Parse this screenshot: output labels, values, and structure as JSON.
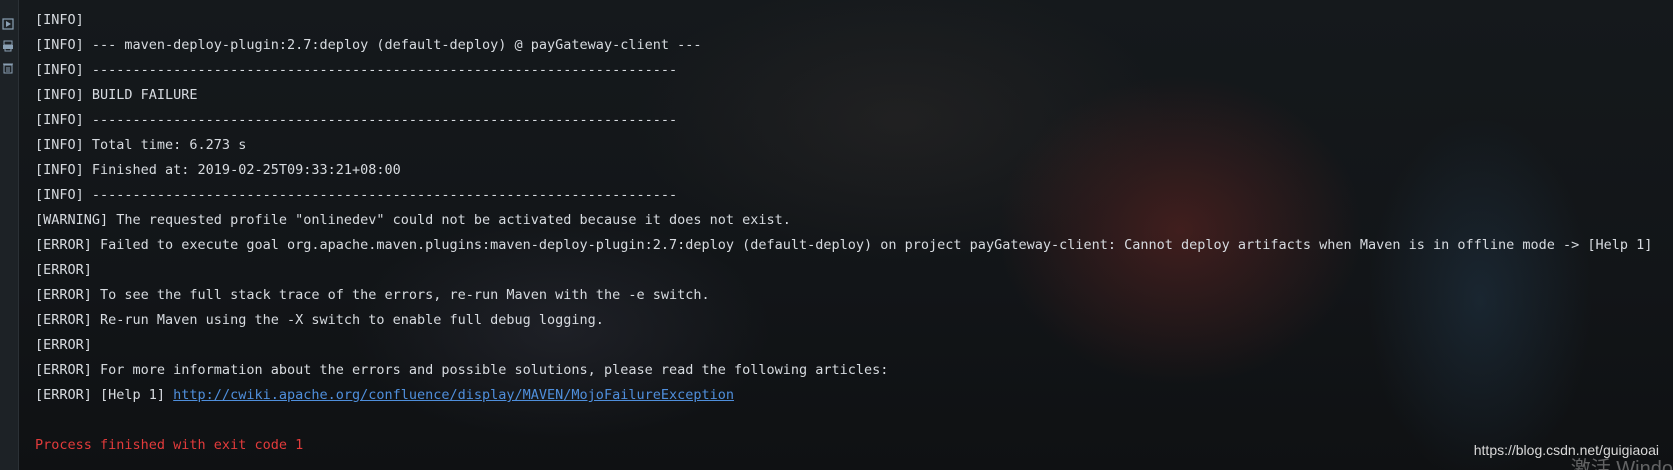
{
  "console": {
    "lines": [
      "[INFO]",
      "[INFO] --- maven-deploy-plugin:2.7:deploy (default-deploy) @ payGateway-client ---",
      "[INFO] ------------------------------------------------------------------------",
      "[INFO] BUILD FAILURE",
      "[INFO] ------------------------------------------------------------------------",
      "[INFO] Total time: 6.273 s",
      "[INFO] Finished at: 2019-02-25T09:33:21+08:00",
      "[INFO] ------------------------------------------------------------------------",
      "[WARNING] The requested profile \"onlinedev\" could not be activated because it does not exist.",
      "[ERROR] Failed to execute goal org.apache.maven.plugins:maven-deploy-plugin:2.7:deploy (default-deploy) on project payGateway-client: Cannot deploy artifacts when Maven is in offline mode -> [Help 1]",
      "[ERROR]",
      "[ERROR] To see the full stack trace of the errors, re-run Maven with the -e switch.",
      "[ERROR] Re-run Maven using the -X switch to enable full debug logging.",
      "[ERROR]",
      "[ERROR] For more information about the errors and possible solutions, please read the following articles:"
    ],
    "help_prefix": "[ERROR] [Help 1] ",
    "help_link": "http://cwiki.apache.org/confluence/display/MAVEN/MojoFailureException",
    "exit_message": "Process finished with exit code 1"
  },
  "gutter_icons": [
    "run-icon",
    "print-icon",
    "delete-icon"
  ],
  "watermark": "https://blog.csdn.net/guigiaoai",
  "activate_text": "激活 Windo",
  "colors": {
    "text": "#d7dbe0",
    "link": "#4f8fdc",
    "error_exit": "#e23b3b",
    "background": "#111416"
  }
}
